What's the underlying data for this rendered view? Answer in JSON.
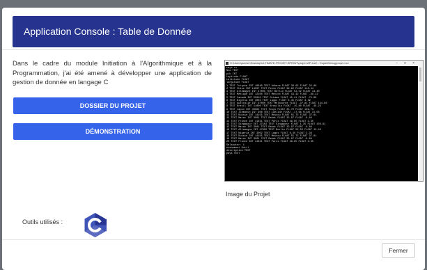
{
  "header": {
    "title": "Application Console : Table de Donnée"
  },
  "description": "Dans le cadre du module Initiation à l'Algorithmique et à la Programmation, j'ai été amené à développer une application de gestion de donnée en langage C",
  "buttons": {
    "dossier": "DOSSIER DU PROJET",
    "demo": "DÉMONSTRATION"
  },
  "console": {
    "title": "C:\\Users\\janvier\\Desktop\\ULTIMATE-PROJET-SPRINT\\projet-IAP-leet\\ - Copie\\Debug\\projet.exe",
    "lines": [
      "Pays 51",
      "Nom TEXT",
      "pib INT",
      "Lapitude FLOAT",
      "Lattitude FLOAT",
      "longitude FLOAT",
      "1 TEXT Turquie INT 10940 TEXT Ankara FLOAT 39.92 FLOAT 32.86",
      "2 TEXT Chine INT 14007 TEXT Pekin FLOAT 39.92 FLOAT 116.44",
      "3 TEXT Allemagne INT 47005 TEXT Berlin FLOAT 52.52 FLOAT 13.40",
      "4 TEXT Mexique INT 12100 TEXT Mexico FLOAT 19.42 FLOAT -99.12",
      "5 TEXT Canada INT 53010 TEXT Ottawa FLOAT 45.41 FLOAT -75.69",
      "6 TEXT Nigeria INT 3002 TEXT Lagos FLOAT 6.45 FLOAT 3.39",
      "7 TEXT Australie INT 67000 TEXT Melbourne FLOAT -37.81 FLOAT 144.96",
      "8 TEXT Bresil INT 11000 TEXT Brasilia FLOAT -15.80 FLOAT -48.23",
      "9 TEXT Japon INT 40062 TEXT Tokyo FLOAT 35.70 FLOAT 139.73",
      "10 TEXT Ilemahun INT 908 TEXT Idelide FLOAT -17.66 FLOAT 31.03",
      "11 TEXT Russie INT 14155 TEXT Moscou FLOAT 55.75 FLOAT 37.61",
      "12 TEXT Maroc INT 3001 TEXT Rabat FLOAT 33.97 FLOAT -6.84",
      "13 TEXT France INT 41621 TEXT Paris FLOAT 48.85 FLOAT 2.35",
      "14 TEXT Singapour INT 27102 TEXT Singapour FLOAT 1.35 FLOAT 103.81",
      "15 TEXT Maroc INT 3001 TEXT Rabat FLOAT 33.97 FLOAT -6.84",
      "16 TEXT Allemagne INT 47005 TEXT Berlin FLOAT 52.52 FLOAT 13.40",
      "17 TEXT Nigeria INT 3002 TEXT Lagos FLOAT 6.45 FLOAT 3.39",
      "18 TEXT Russie INT 14155 TEXT Moscou FLOAT 55.75 FLOAT 37.61",
      "19 TEXT Maroc INT 3001 TEXT Rabat FLOAT 33.97 FLOAT -6.84",
      "20 TEXT France INT 41621 TEXT Paris FLOAT 48.85 FLOAT 2.35",
      "Selsauter: 1",
      "evenement Outil",
      "description TEXT",
      "pays TEXT"
    ]
  },
  "caption": "Image du Projet",
  "tools": {
    "label": "Outils utilisés :",
    "logo_icon": "c-language-icon"
  },
  "footer": {
    "close": "Fermer"
  },
  "colors": {
    "header_bg": "#26338f",
    "button_bg": "#3563ea",
    "backdrop": "#6b7177"
  }
}
